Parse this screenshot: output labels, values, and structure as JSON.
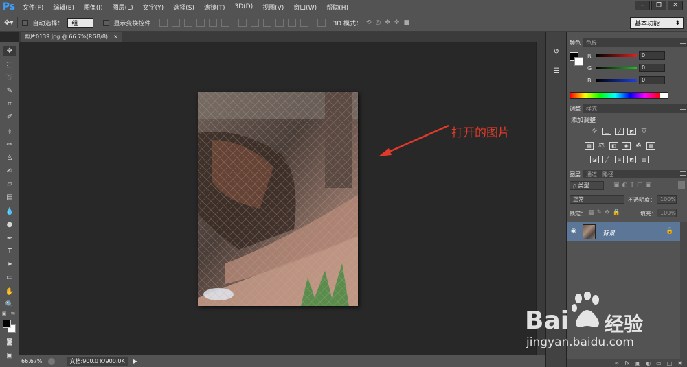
{
  "app": {
    "logo": "Ps"
  },
  "menu": [
    "文件(F)",
    "编辑(E)",
    "图像(I)",
    "图层(L)",
    "文字(Y)",
    "选择(S)",
    "滤镜(T)",
    "3D(D)",
    "视图(V)",
    "窗口(W)",
    "帮助(H)"
  ],
  "options": {
    "auto_select_label": "自动选择：",
    "auto_select_value": "组",
    "transform_label": "显示变换控件",
    "mode_3d_label": "3D 模式：",
    "workspace": "基本功能"
  },
  "document": {
    "tab_title": "照片0139.jpg @ 66.7%(RGB/8)",
    "close": "×"
  },
  "status": {
    "zoom": "66.67%",
    "doc_size": "文档:900.0 K/900.0K"
  },
  "panels": {
    "color": {
      "tabs": [
        "颜色",
        "色板"
      ],
      "channels": [
        {
          "label": "R",
          "value": "0",
          "color": "#e02020"
        },
        {
          "label": "G",
          "value": "0",
          "color": "#20c020"
        },
        {
          "label": "B",
          "value": "0",
          "color": "#2040e0"
        }
      ]
    },
    "adjust": {
      "tabs": [
        "调整",
        "样式"
      ],
      "title": "添加调整"
    },
    "layers": {
      "tabs": [
        "图层",
        "通道",
        "路径"
      ],
      "filter": "ρ 类型",
      "blend": "正常",
      "opacity_label": "不透明度：",
      "opacity_value": "100%",
      "lock_label": "锁定：",
      "fill_label": "填充：",
      "fill_value": "100%",
      "layer_name": "背景"
    }
  },
  "annotation": "打开的图片",
  "watermark": {
    "brand": "Bai",
    "brand2": "经验",
    "url": "jingyan.baidu.com"
  }
}
